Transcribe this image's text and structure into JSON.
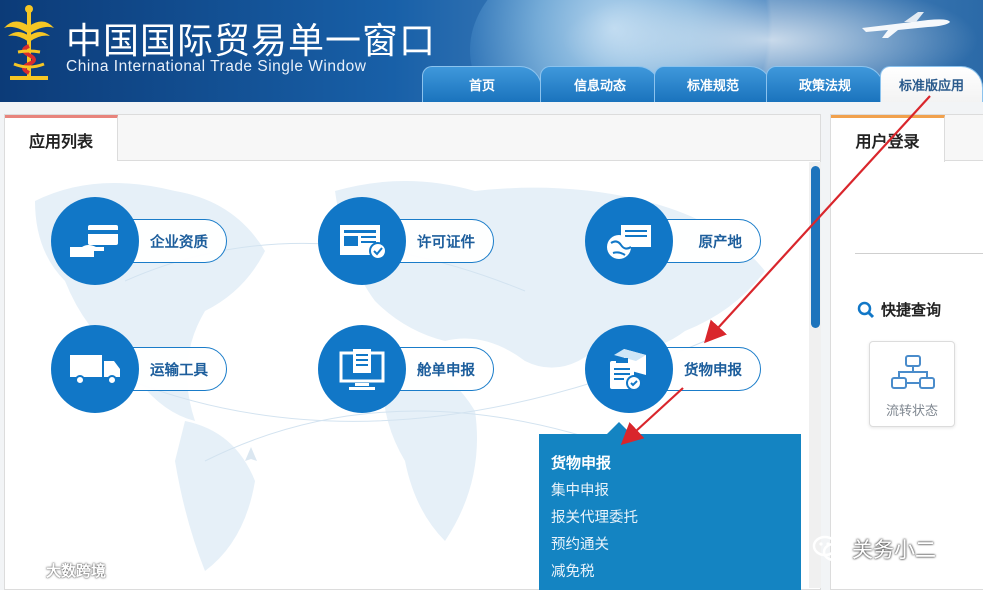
{
  "header": {
    "title_cn": "中国国际贸易单一窗口",
    "title_en": "China International Trade Single Window"
  },
  "nav": {
    "tabs": [
      {
        "label": "首页"
      },
      {
        "label": "信息动态"
      },
      {
        "label": "标准规范"
      },
      {
        "label": "政策法规"
      },
      {
        "label": "标准版应用",
        "active": true
      }
    ]
  },
  "app_list": {
    "tab_label": "应用列表",
    "items": [
      {
        "label": "企业资质",
        "icon": "card-hand-icon"
      },
      {
        "label": "许可证件",
        "icon": "certificate-icon"
      },
      {
        "label": "原产地",
        "icon": "globe-document-icon"
      },
      {
        "label": "运输工具",
        "icon": "truck-icon"
      },
      {
        "label": "舱单申报",
        "icon": "monitor-document-icon"
      },
      {
        "label": "货物申报",
        "icon": "cargo-clipboard-icon"
      }
    ],
    "dropdown": {
      "header": "货物申报",
      "items": [
        "集中申报",
        "报关代理委托",
        "预约通关",
        "减免税"
      ]
    }
  },
  "user_login": {
    "tab_label": "用户登录",
    "quick_query_label": "快捷查询",
    "flow_status_label": "流转状态"
  },
  "watermarks": {
    "left": "大数跨境",
    "right": "关务小二"
  },
  "colors": {
    "brand_blue": "#1177c7",
    "dropdown_bg": "#1484c2",
    "arrow_red": "#d9262c",
    "tab_accent_left": "#e8847c",
    "tab_accent_right": "#f1a14d"
  }
}
